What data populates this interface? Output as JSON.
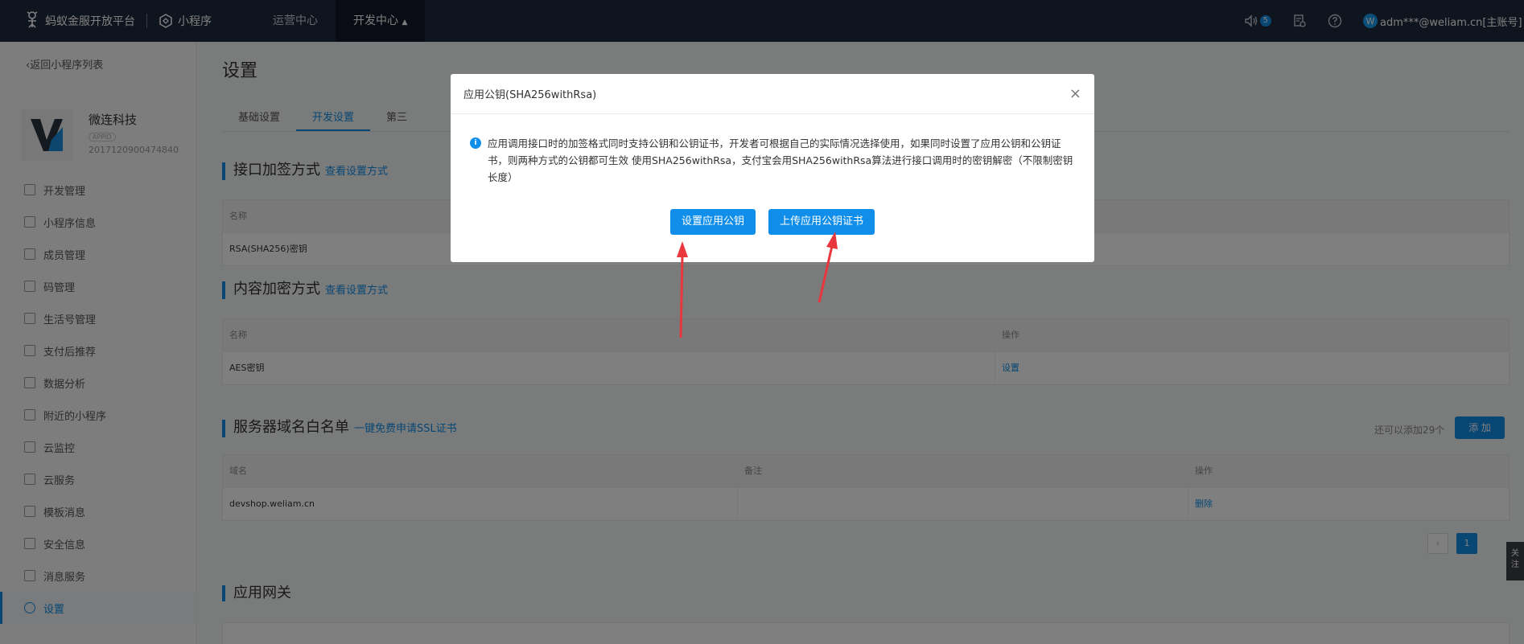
{
  "topbar": {
    "brand": "蚂蚁金服开放平台",
    "product": "小程序",
    "nav": [
      "运营中心",
      "开发中心"
    ],
    "notif_count": "5",
    "user": "adm***@weliam.cn[主账号]",
    "user_avatar": "W"
  },
  "sidebar": {
    "back": "返回小程序列表",
    "app_name": "微连科技",
    "appid_tag": "APPID",
    "appid": "2017120900474840",
    "items": [
      "开发管理",
      "小程序信息",
      "成员管理",
      "码管理",
      "生活号管理",
      "支付后推荐",
      "数据分析",
      "附近的小程序",
      "云监控",
      "云服务",
      "模板消息",
      "安全信息",
      "消息服务",
      "设置"
    ]
  },
  "main": {
    "title": "设置",
    "tabs": [
      "基础设置",
      "开发设置",
      "第三"
    ],
    "sign": {
      "title": "接口加签方式",
      "link": "查看设置方式",
      "col_name": "名称",
      "row_name": "RSA(SHA256)密钥"
    },
    "encrypt": {
      "title": "内容加密方式",
      "link": "查看设置方式",
      "col_name": "名称",
      "col_op": "操作",
      "row_name": "AES密钥",
      "row_op": "设置"
    },
    "domain": {
      "title": "服务器域名白名单",
      "link": "一键免费申请SSL证书",
      "remain": "还可以添加29个",
      "add": "添 加",
      "col_domain": "域名",
      "col_note": "备注",
      "col_op": "操作",
      "row_domain": "devshop.weliam.cn",
      "row_op": "删除"
    },
    "pager": {
      "prev": "‹",
      "page": "1"
    },
    "gateway": {
      "title": "应用网关"
    },
    "float_text": "关\n注"
  },
  "modal": {
    "title": "应用公钥(SHA256withRsa)",
    "info_icon": "i",
    "text": "应用调用接口时的加签格式同时支持公钥和公钥证书，开发者可根据自己的实际情况选择使用，如果同时设置了应用公钥和公钥证书，则两种方式的公钥都可生效 使用SHA256withRsa，支付宝会用SHA256withRsa算法进行接口调用时的密钥解密（不限制密钥长度）",
    "btn_set": "设置应用公钥",
    "btn_upload": "上传应用公钥证书",
    "close": "×"
  },
  "colors": {
    "accent": "#108ee9",
    "topbar": "#1f2a3c",
    "arrow": "#e8383d"
  }
}
